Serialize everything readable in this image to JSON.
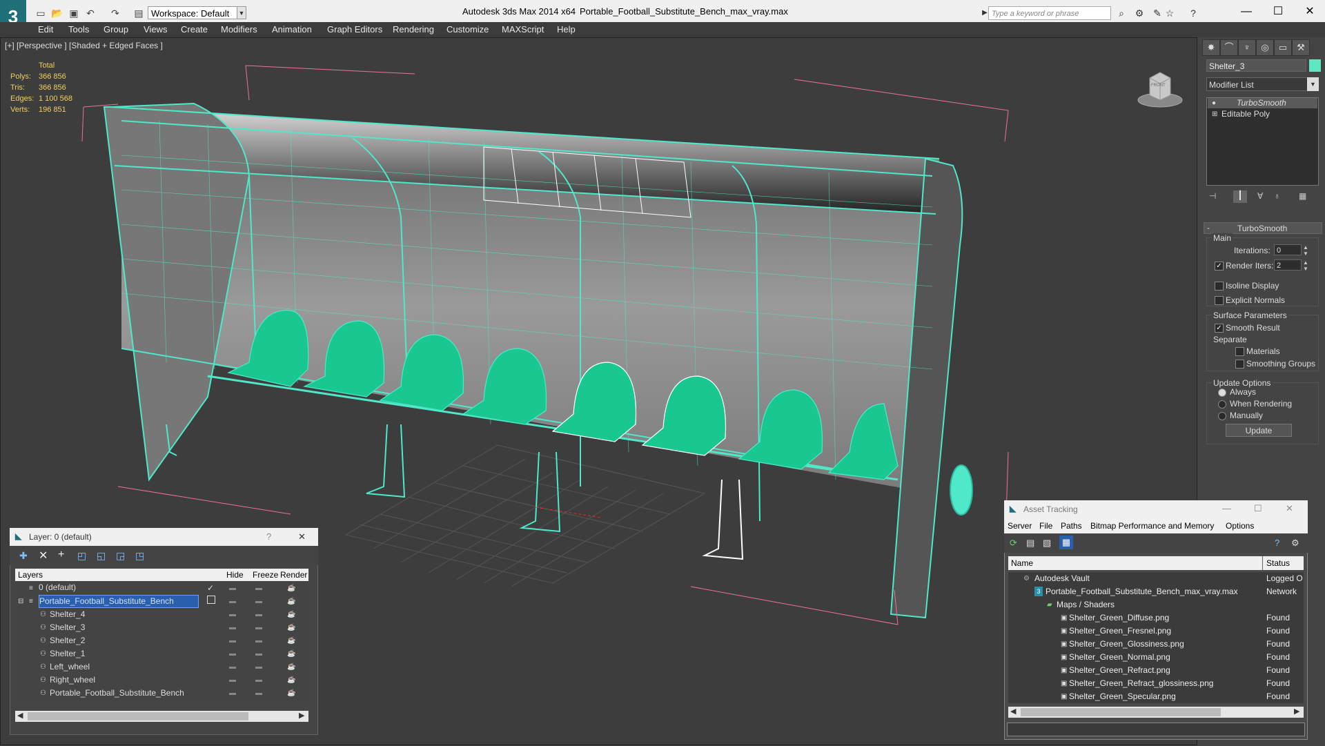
{
  "app": {
    "title": "Autodesk 3ds Max  2014 x64",
    "file": "Portable_Football_Substitute_Bench_max_vray.max",
    "workspace": "Workspace: Default",
    "search_placeholder": "Type a keyword or phrase",
    "logo": "3"
  },
  "menu": [
    "Edit",
    "Tools",
    "Group",
    "Views",
    "Create",
    "Modifiers",
    "Animation",
    "Graph Editors",
    "Rendering",
    "Customize",
    "MAXScript",
    "Help"
  ],
  "viewport": {
    "label": "[+] [Perspective ] [Shaded + Edged Faces ]",
    "stats": {
      "total_label": "Total",
      "polys_label": "Polys:",
      "polys": "366 856",
      "tris_label": "Tris:",
      "tris": "366 856",
      "edges_label": "Edges:",
      "edges": "1 100 568",
      "verts_label": "Verts:",
      "verts": "196 851"
    },
    "viewcube_label": "FRONT"
  },
  "command_panel": {
    "object_name": "Shelter_3",
    "object_color": "#5fe8c0",
    "modifier_list": "Modifier List",
    "stack": [
      "TurboSmooth",
      "Editable Poly"
    ],
    "turbosmooth": {
      "title": "TurboSmooth",
      "main_label": "Main",
      "iterations_label": "Iterations:",
      "iterations": "0",
      "render_iters_label": "Render Iters:",
      "render_iters": "2",
      "render_iters_checked": true,
      "isoline_label": "Isoline Display",
      "explicit_label": "Explicit Normals",
      "surface_label": "Surface Parameters",
      "smooth_result_label": "Smooth Result",
      "separate_label": "Separate",
      "materials_label": "Materials",
      "smoothing_groups_label": "Smoothing Groups",
      "update_options_label": "Update Options",
      "always_label": "Always",
      "when_rendering_label": "When Rendering",
      "manually_label": "Manually",
      "update_button": "Update"
    }
  },
  "layer_explorer": {
    "title": "Layer: 0 (default)",
    "help": "?",
    "close": "✕",
    "columns": [
      "Layers",
      "Hide",
      "Freeze",
      "Render"
    ],
    "rows": [
      {
        "name": "0 (default)",
        "indent": 0,
        "checked": true
      },
      {
        "name": "Portable_Football_Substitute_Bench",
        "indent": 0,
        "selected": true
      },
      {
        "name": "Shelter_4",
        "indent": 1
      },
      {
        "name": "Shelter_3",
        "indent": 1
      },
      {
        "name": "Shelter_2",
        "indent": 1
      },
      {
        "name": "Shelter_1",
        "indent": 1
      },
      {
        "name": "Left_wheel",
        "indent": 1
      },
      {
        "name": "Right_wheel",
        "indent": 1
      },
      {
        "name": "Portable_Football_Substitute_Bench",
        "indent": 1
      }
    ]
  },
  "asset_tracking": {
    "title": "Asset Tracking",
    "menu": [
      "Server",
      "File",
      "Paths",
      "Bitmap Performance and Memory",
      "Options"
    ],
    "columns": [
      "Name",
      "Status"
    ],
    "rows": [
      {
        "name": "Autodesk Vault",
        "status": "Logged O",
        "indent": 1
      },
      {
        "name": "Portable_Football_Substitute_Bench_max_vray.max",
        "status": "Network F",
        "indent": 2
      },
      {
        "name": "Maps / Shaders",
        "status": "",
        "indent": 3
      },
      {
        "name": "Shelter_Green_Diffuse.png",
        "status": "Found",
        "indent": 4
      },
      {
        "name": "Shelter_Green_Fresnel.png",
        "status": "Found",
        "indent": 4
      },
      {
        "name": "Shelter_Green_Glossiness.png",
        "status": "Found",
        "indent": 4
      },
      {
        "name": "Shelter_Green_Normal.png",
        "status": "Found",
        "indent": 4
      },
      {
        "name": "Shelter_Green_Refract.png",
        "status": "Found",
        "indent": 4
      },
      {
        "name": "Shelter_Green_Refract_glossiness.png",
        "status": "Found",
        "indent": 4
      },
      {
        "name": "Shelter_Green_Specular.png",
        "status": "Found",
        "indent": 4
      }
    ]
  },
  "colors": {
    "wire": "#4fe8c8",
    "seat": "#18c890",
    "accent": "#2a5fae"
  }
}
